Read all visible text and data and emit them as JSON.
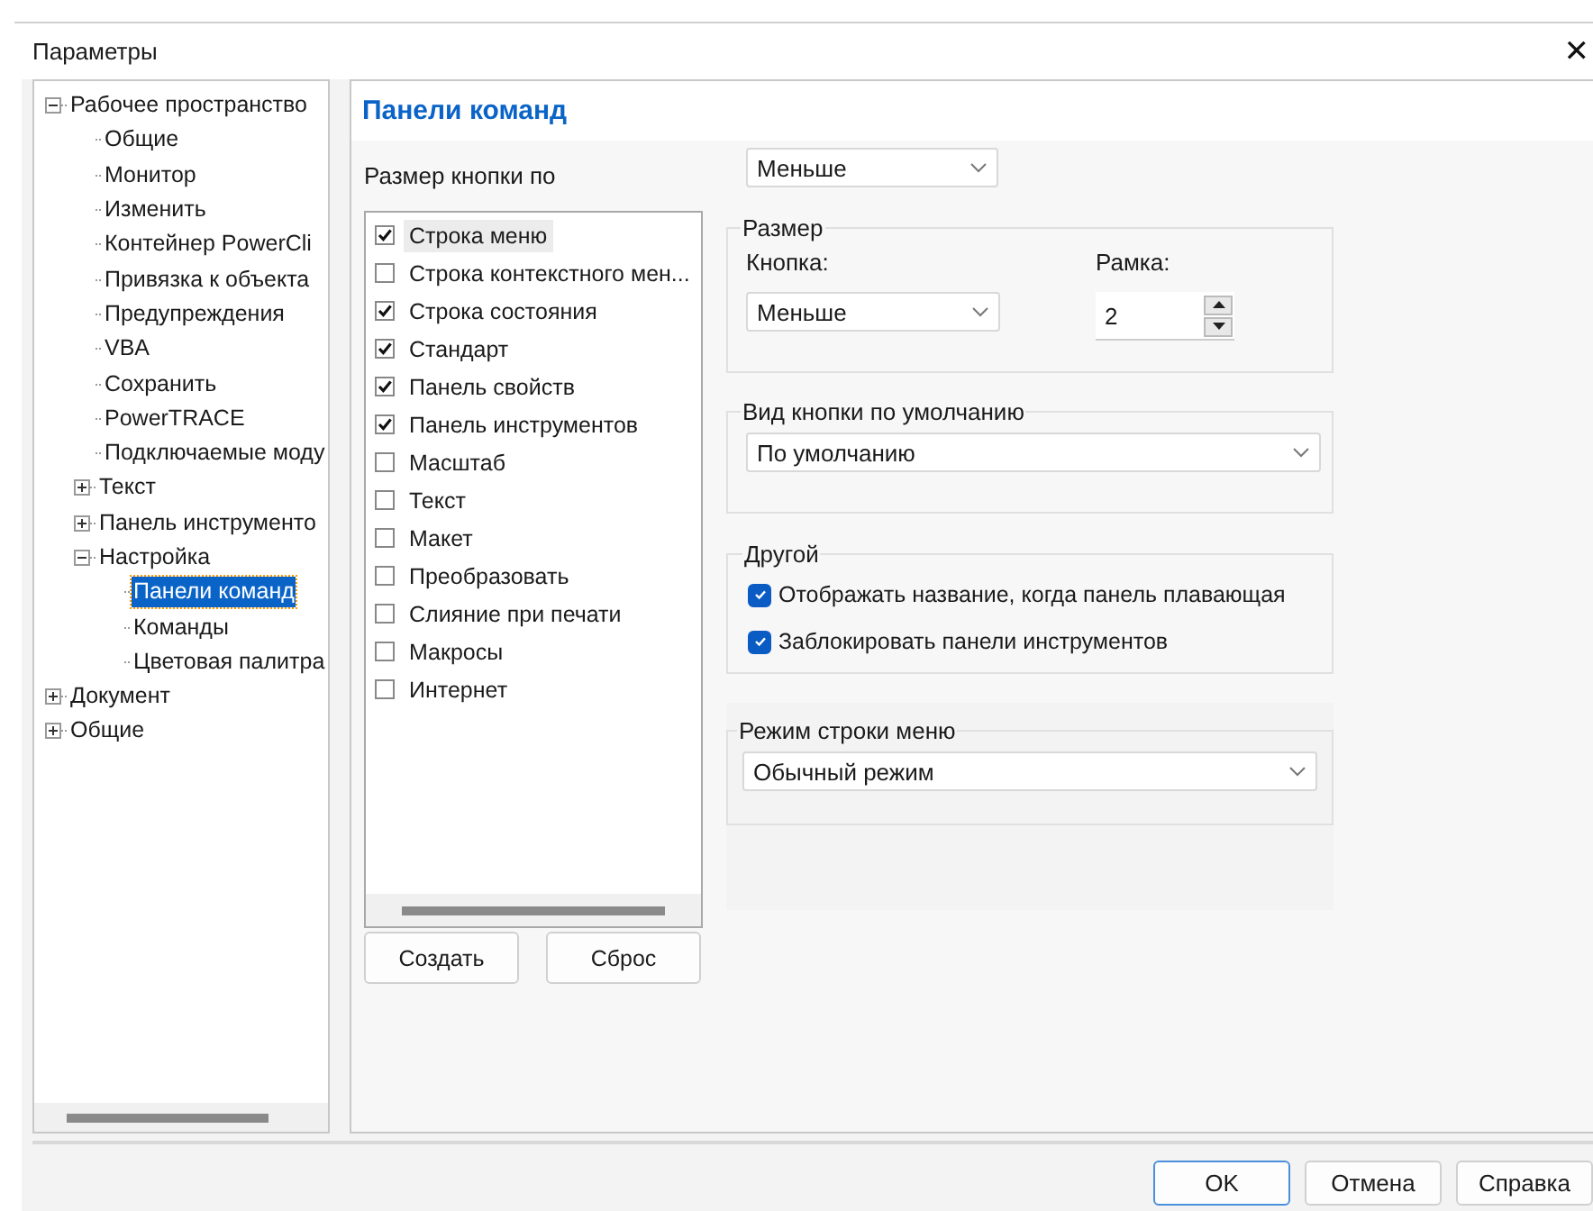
{
  "window": {
    "title": "Параметры",
    "close": "✕"
  },
  "tree": [
    {
      "label": "Рабочее пространство",
      "expanded": true,
      "selected": false,
      "children": [
        {
          "label": "Общие",
          "selected": false
        },
        {
          "label": "Монитор",
          "selected": false
        },
        {
          "label": "Изменить",
          "selected": false
        },
        {
          "label": "Контейнер PowerCli",
          "selected": false
        },
        {
          "label": "Привязка к объекта",
          "selected": false
        },
        {
          "label": "Предупреждения",
          "selected": false
        },
        {
          "label": "VBA",
          "selected": false
        },
        {
          "label": "Сохранить",
          "selected": false
        },
        {
          "label": "PowerTRACE",
          "selected": false
        },
        {
          "label": "Подключаемые моду",
          "selected": false
        },
        {
          "label": "Текст",
          "expanded": false,
          "selected": false
        },
        {
          "label": "Панель инструменто",
          "expanded": false,
          "selected": false
        },
        {
          "label": "Настройка",
          "expanded": true,
          "selected": false,
          "children": [
            {
              "label": "Панели команд",
              "selected": true
            },
            {
              "label": "Команды",
              "selected": false
            },
            {
              "label": "Цветовая палитра",
              "selected": false
            }
          ]
        }
      ]
    },
    {
      "label": "Документ",
      "expanded": false,
      "selected": false
    },
    {
      "label": "Общие",
      "expanded": false,
      "selected": false
    }
  ],
  "page_title": "Панели команд",
  "button_size": {
    "label": "Размер кнопки по",
    "value": "Меньше"
  },
  "toolbars": [
    {
      "label": "Строка меню",
      "checked": true,
      "selected": true
    },
    {
      "label": "Строка контекстного мен...",
      "checked": false,
      "selected": false
    },
    {
      "label": "Строка состояния",
      "checked": true,
      "selected": false
    },
    {
      "label": "Стандарт",
      "checked": true,
      "selected": false
    },
    {
      "label": "Панель свойств",
      "checked": true,
      "selected": false
    },
    {
      "label": "Панель инструментов",
      "checked": true,
      "selected": false
    },
    {
      "label": "Масштаб",
      "checked": false,
      "selected": false
    },
    {
      "label": "Текст",
      "checked": false,
      "selected": false
    },
    {
      "label": "Макет",
      "checked": false,
      "selected": false
    },
    {
      "label": "Преобразовать",
      "checked": false,
      "selected": false
    },
    {
      "label": "Слияние при печати",
      "checked": false,
      "selected": false
    },
    {
      "label": "Макросы",
      "checked": false,
      "selected": false
    },
    {
      "label": "Интернет",
      "checked": false,
      "selected": false
    }
  ],
  "list_buttons": [
    "Создать",
    "Сброс"
  ],
  "size_group": {
    "title": "Размер",
    "button_label": "Кнопка:",
    "button_value": "Меньше",
    "frame_label": "Рамка:",
    "frame_value": "2"
  },
  "default_view": {
    "title": "Вид кнопки по умолчанию",
    "value": "По умолчанию"
  },
  "other": {
    "title": "Другой",
    "options": [
      {
        "label": "Отображать название, когда панель плавающая",
        "checked": true
      },
      {
        "label": "Заблокировать панели инструментов",
        "checked": true
      }
    ]
  },
  "menu_mode": {
    "title": "Режим строки меню",
    "value": "Обычный режим"
  },
  "buttons": [
    {
      "label": "OK",
      "default": true
    },
    {
      "label": "Отмена",
      "default": false
    },
    {
      "label": "Справка",
      "default": false
    }
  ]
}
